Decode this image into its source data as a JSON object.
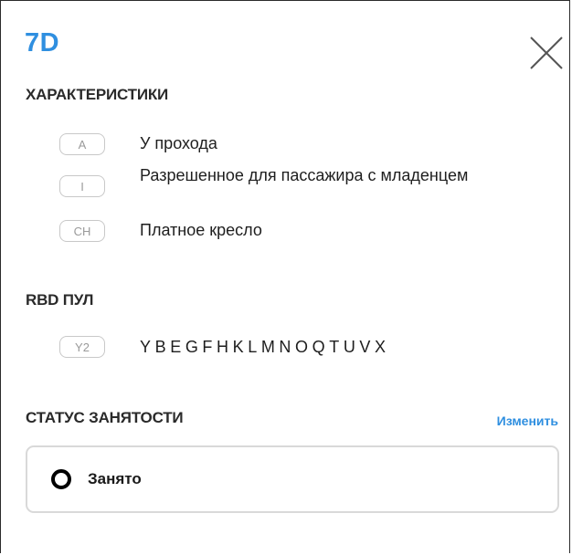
{
  "seat": {
    "number": "7D"
  },
  "characteristics": {
    "heading": "ХАРАКТЕРИСТИКИ",
    "items": [
      {
        "code": "A",
        "label": "У прохода"
      },
      {
        "code": "I",
        "label": "Разрешенное для пассажира с младенцем"
      },
      {
        "code": "CH",
        "label": "Платное кресло"
      }
    ]
  },
  "rbd_pool": {
    "heading": "RBD ПУЛ",
    "code": "Y2",
    "classes": "YBEGFHKLMNOQTUVX"
  },
  "occupancy": {
    "heading": "СТАТУС ЗАНЯТОСТИ",
    "change_label": "Изменить",
    "status_label": "Занято"
  },
  "icons": {
    "close": "close-icon",
    "status": "status-ring-icon"
  },
  "colors": {
    "accent": "#2f8fe0",
    "chip_border": "#c8c8c8",
    "chip_text": "#9a9a9a",
    "status_ring": "#000000"
  }
}
